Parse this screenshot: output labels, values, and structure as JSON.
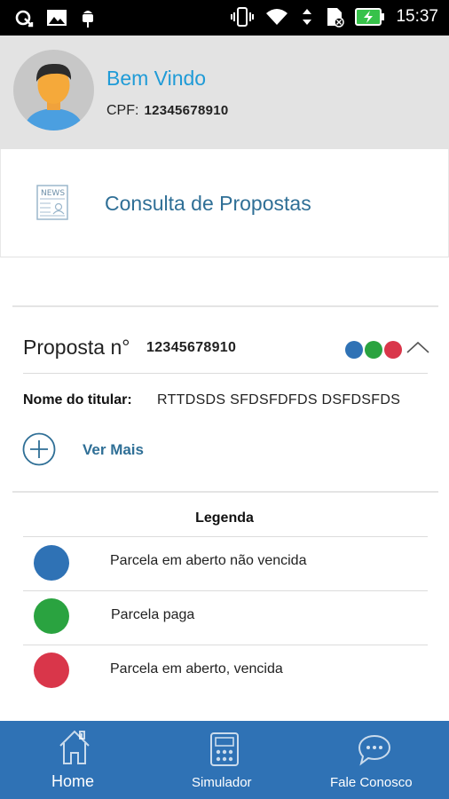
{
  "status_bar": {
    "time": "15:37",
    "icons": [
      "data-sync-icon",
      "image-icon",
      "android-debug-icon",
      "vibrate-icon",
      "wifi-icon",
      "signal-icon",
      "sim-icon",
      "battery-charging-icon"
    ]
  },
  "header": {
    "welcome": "Bem Vindo",
    "cpf_label": "CPF:",
    "cpf_value": "12345678910"
  },
  "consulta": {
    "label": "Consulta de Propostas",
    "icon": "news-icon"
  },
  "proposta": {
    "title": "Proposta n°",
    "number": "12345678910",
    "status_dots": [
      "#2f72b5",
      "#2aa340",
      "#d9364a"
    ],
    "titular_label": "Nome do titular:",
    "titular_value": "RTTDSDS SFDSFDFDS DSFDSFDS",
    "ver_mais": "Ver Mais"
  },
  "legenda": {
    "title": "Legenda",
    "items": [
      {
        "label": "Parcela em aberto não vencida",
        "color": "#2f72b5"
      },
      {
        "label": "Parcela paga",
        "color": "#2aa340"
      },
      {
        "label": "Parcela em aberto, vencida",
        "color": "#d9364a"
      }
    ]
  },
  "bottom_nav": {
    "items": [
      {
        "label": "Home",
        "icon": "home-icon"
      },
      {
        "label": "Simulador",
        "icon": "calculator-icon"
      },
      {
        "label": "Fale Conosco",
        "icon": "chat-icon"
      }
    ]
  },
  "colors": {
    "accent": "#1f9bd7",
    "link": "#2f6f96",
    "nav_background": "#2f72b5"
  }
}
